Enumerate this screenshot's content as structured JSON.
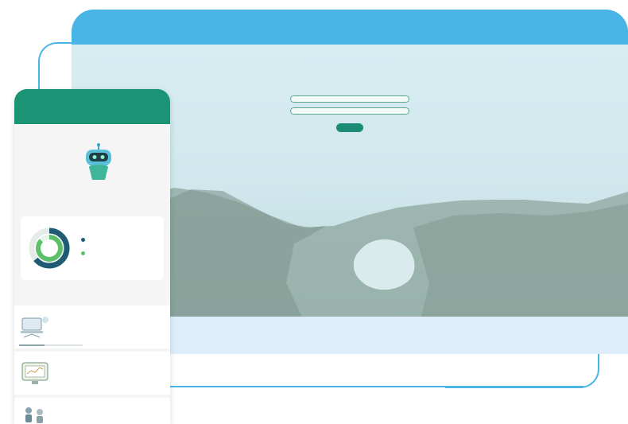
{
  "colors": {
    "brand_blue": "#48b5e6",
    "brand_green": "#1a9474",
    "accent_green": "#2aa78b",
    "card_bg": "#ffffff"
  },
  "desktop": {
    "login": {
      "title": "",
      "subtitle": "",
      "username_placeholder": "",
      "password_placeholder": "",
      "remember_label": "",
      "login_button": ""
    }
  },
  "phone": {
    "status_time": "",
    "status_icons": "",
    "title": "",
    "hero_label": "",
    "intro_text": "",
    "stats": [
      {
        "label": "",
        "color": "#1f5b73",
        "percent": 64
      },
      {
        "label": "",
        "color": "#5cbf6a",
        "percent": 87
      }
    ],
    "section_label": "",
    "courses": [
      {
        "title": "",
        "meta_1": "",
        "meta_2": "",
        "progress": 0.4,
        "icon": "laptop-illustration-icon"
      },
      {
        "title": "",
        "meta_1": "",
        "meta_2": "",
        "progress": 0.0,
        "icon": "screen-chart-illustration-icon"
      },
      {
        "title": "",
        "meta_1": "",
        "meta_2": "",
        "progress": 0.0,
        "icon": "people-illustration-icon"
      }
    ]
  }
}
